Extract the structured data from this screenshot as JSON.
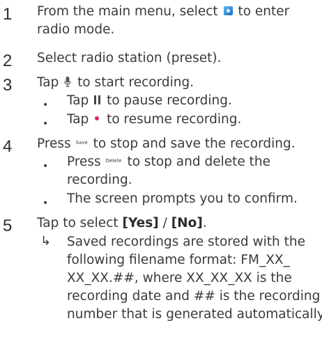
{
  "steps": [
    {
      "number": "1",
      "text_before_icon": "From the main menu, select",
      "icon": "radio-mode-icon",
      "text_after_icon": "to enter",
      "continuation": "radio mode."
    },
    {
      "number": "2",
      "text": "Select radio station (preset)."
    },
    {
      "number": "3",
      "text_before_icon": "Tap",
      "icon": "microphone-icon",
      "text_after_icon": "to start recording.",
      "bullets": [
        {
          "before": "Tap",
          "icon": "pause-icon",
          "after": "to pause recording."
        },
        {
          "before": "Tap",
          "icon": "record-dot-icon",
          "after": "to resume recording."
        }
      ]
    },
    {
      "number": "4",
      "text_before_icon": "Press",
      "icon_label": "Save",
      "text_after_icon": "to stop and save the recording.",
      "bullets": [
        {
          "before": "Press",
          "icon_label": "Delete",
          "after": "to stop and delete the",
          "continuation": "recording."
        },
        {
          "text": "The screen prompts you to confirm."
        }
      ]
    },
    {
      "number": "5",
      "text_before": "Tap to select",
      "yes": "[Yes]",
      "separator": "/",
      "no": "[No]",
      "period": ".",
      "result_arrow": "↳",
      "result_lines": [
        "Saved recordings are stored with the",
        "following filename format: FM_XX_",
        "XX_XX.##, where XX_XX_XX is the",
        "recording date and ## is the recording",
        "number that is generated automatically."
      ]
    }
  ],
  "bullet_char": "•",
  "colors": {
    "text": "#3a3a3a",
    "radio_icon": "#1a6fc4",
    "record_dot": "#e0245e"
  }
}
